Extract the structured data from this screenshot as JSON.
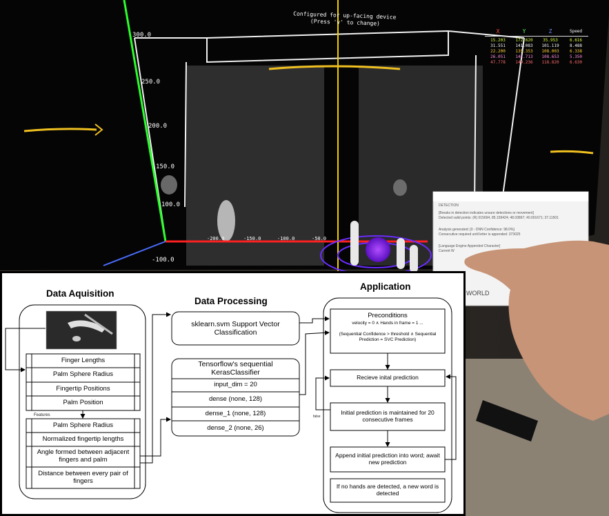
{
  "photo": {
    "hud_header": [
      "Configured for up-facing device",
      "(Press 'v' to change)"
    ],
    "axis_labels_y": [
      "300.0",
      "250.0",
      "200.0",
      "150.0",
      "100.0",
      "-100.0"
    ],
    "axis_labels_x": [
      "-200.0",
      "-150.0",
      "-100.0",
      "-50.0"
    ],
    "coord_table": {
      "headers": [
        "X",
        "Y",
        "Z",
        "Speed"
      ],
      "header_colors": [
        "#ff4a3d",
        "#5aff5a",
        "#6f8dff",
        "#ffffff"
      ],
      "rows": [
        [
          "15.203",
          "172.620",
          "35.953",
          "6.616"
        ],
        [
          "31.551",
          "141.083",
          "101.119",
          "8.488"
        ],
        [
          "22.200",
          "135.353",
          "108.003",
          "6.338"
        ],
        [
          "26.051",
          "141.713",
          "108.653",
          "5.350"
        ],
        [
          "47.778",
          "149.236",
          "118.820",
          "6.630"
        ]
      ],
      "row_colors": [
        "#d6ff3a",
        "#ffffff",
        "#ffd23a",
        "#ff8fe0",
        "#ff6a6a"
      ]
    },
    "popup": {
      "title": "DETECTION",
      "lines": [
        "[Breaks in detection indicates unsure detections or movement]",
        "Detected valid points: (R) 015694, 85.159424; 48.03867; 40.001671; 37.11501",
        "Analysis generated: [0 - DNN Confidence: 98.0%]",
        "Consecutive required until letter is appended: 373025",
        "[Language Engine Appended Character]",
        "Current W"
      ],
      "world_text": "WORLD"
    }
  },
  "diagram": {
    "data_acquisition": {
      "title": "Data Aquisition",
      "raw_items": [
        "Finger Lengths",
        "Palm Sphere Radius",
        "Fingertip Positions",
        "Palm Position"
      ],
      "features_label": "Features",
      "feature_items": [
        "Palm Sphere Radius",
        "Normalized fingertip lengths",
        "Angle formed between adjacent fingers and palm",
        "Distance between every pair of fingers"
      ]
    },
    "data_processing": {
      "title": "Data Processing",
      "svm_label": "sklearn.svm Support Vector Classification",
      "keras_title": "Tensorflow's sequential KerasClassifier",
      "keras_layers": [
        "input_dim = 20",
        "dense (none, 128)",
        "dense_1 (none, 128)",
        "dense_2 (none, 26)"
      ]
    },
    "application": {
      "title": "Application",
      "preconditions_title": "Preconditions",
      "preconditions_line1": "velocity = 0 ∧ Hands in frame = 1 ...",
      "preconditions_line2": "(Sequential Confidence > threshold ∧ Sequential Prediction = SVC Prediction)",
      "steps": [
        "Recieve inital prediction",
        "Initial prediction is maintained for 20 consecutive frames",
        "Append initial prediction into word; await new prediction",
        "If no hands are detected, a new word is detected"
      ],
      "false_label": "false"
    }
  }
}
